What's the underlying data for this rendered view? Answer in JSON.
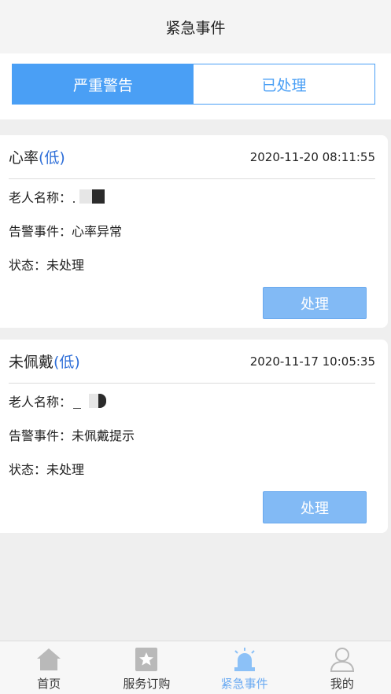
{
  "header": {
    "title": "紧急事件"
  },
  "tabs": [
    {
      "label": "严重警告",
      "active": true
    },
    {
      "label": "已处理",
      "active": false
    }
  ],
  "events": [
    {
      "title": "心率",
      "level": "(低)",
      "time": "2020-11-20 08:11:55",
      "elder_label": "老人名称：",
      "alarm_label": "告警事件：",
      "alarm_value": "心率异常",
      "status_label": "状态：",
      "status_value": "未处理",
      "action_label": "处理"
    },
    {
      "title": "未佩戴",
      "level": "(低)",
      "time": "2020-11-17 10:05:35",
      "elder_label": "老人名称：",
      "alarm_label": "告警事件：",
      "alarm_value": "未佩戴提示",
      "status_label": "状态：",
      "status_value": "未处理",
      "action_label": "处理"
    }
  ],
  "tabbar": [
    {
      "label": "首页",
      "icon": "home-icon",
      "active": false
    },
    {
      "label": "服务订购",
      "icon": "star-bookmark-icon",
      "active": false
    },
    {
      "label": "紧急事件",
      "icon": "alarm-siren-icon",
      "active": true
    },
    {
      "label": "我的",
      "icon": "user-icon",
      "active": false
    }
  ],
  "colors": {
    "accent": "#4a9ff5",
    "level_text": "#2f6fd8",
    "button": "#82baf5",
    "tab_active_label": "#6aaaf2"
  }
}
